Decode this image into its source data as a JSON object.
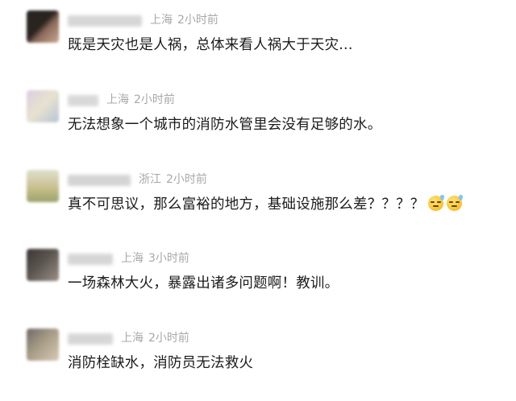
{
  "comments": [
    {
      "location": "上海",
      "time": "2小时前",
      "text": "既是天灾也是人祸，总体来看人祸大于天灾...",
      "avatar_colors": [
        "#2a2420",
        "#8a6a5a",
        "#c9a690"
      ]
    },
    {
      "location": "上海",
      "time": "2小时前",
      "text": "无法想象一个城市的消防水管里会没有足够的水。",
      "avatar_colors": [
        "#d9cfe0",
        "#e7e2cf",
        "#b9c3d6"
      ]
    },
    {
      "location": "浙江",
      "time": "2小时前",
      "text": "真不可思议，那么富裕的地方，基础设施那么差？？？？",
      "avatar_colors": [
        "#c9c08e",
        "#dfe0cf",
        "#9aa36a"
      ]
    },
    {
      "location": "上海",
      "time": "3小时前",
      "text": "一场森林大火，暴露出诸多问题啊！教训。",
      "avatar_colors": [
        "#3a3634",
        "#9a8f86",
        "#5b5550"
      ]
    },
    {
      "location": "上海",
      "time": "2小时前",
      "text": "消防栓缺水，消防员无法救火",
      "avatar_colors": [
        "#a69b84",
        "#d7cab5",
        "#6d6a6a"
      ]
    }
  ],
  "emoji": [
    "sweat-smile-emoji",
    "sweat-smile-emoji"
  ]
}
